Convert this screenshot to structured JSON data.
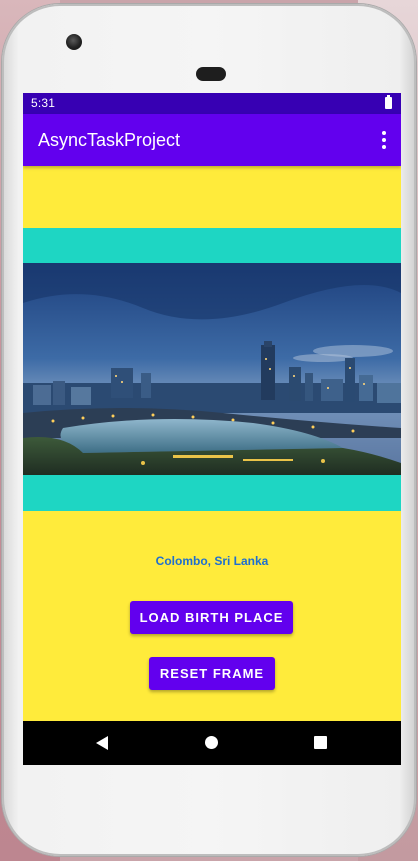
{
  "status_bar": {
    "time": "5:31",
    "battery_icon": "battery-full-icon"
  },
  "app_bar": {
    "title": "AsyncTaskProject",
    "menu_icon": "overflow-menu-icon"
  },
  "image": {
    "subject": "city-skyline-photo"
  },
  "location_text": "Colombo, Sri Lanka",
  "buttons": {
    "load_birth_place": "LOAD BIRTH PLACE",
    "reset_frame": "RESET FRAME"
  },
  "nav_bar": {
    "back_icon": "back-icon",
    "home_icon": "home-icon",
    "recents_icon": "recents-icon"
  },
  "colors": {
    "status_bar": "#3700b3",
    "app_bar": "#6200ee",
    "background": "#ffeb3b",
    "frame": "#1ed6c3",
    "button": "#6200ee",
    "location_text": "#1e6fd0"
  }
}
